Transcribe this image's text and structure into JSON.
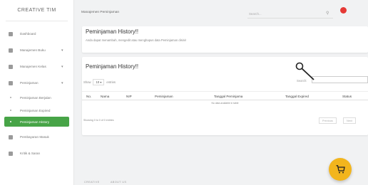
{
  "brand": "CREATIVE TIM",
  "sidebar": {
    "items": [
      {
        "label": "Dashboard"
      },
      {
        "label": "Manajemen Buku"
      },
      {
        "label": "Manajemen Kelas"
      },
      {
        "label": "Peminjaman"
      }
    ],
    "sub_items": [
      {
        "label": "Peminjaman Berjalan"
      },
      {
        "label": "Peminjaman Expired"
      },
      {
        "label": "Peminjaman History"
      }
    ],
    "more_items": [
      {
        "label": "Pembayaran Masuk"
      },
      {
        "label": "Kritik & Saran"
      }
    ]
  },
  "topbar": {
    "breadcrumb": "Manajemen Peminjaman",
    "search_placeholder": "Search..."
  },
  "header_card": {
    "title": "Peminjaman History!!",
    "subtitle": "Anda dapat menambah, mengedit atau menghapus data Peminjaman disini!"
  },
  "table_card": {
    "title": "Peminjaman History!!",
    "show_label": "Show",
    "entries_value": "10",
    "entries_label": "entries",
    "search_label": "Search:",
    "columns": [
      "No.",
      "Nama",
      "NIP",
      "Peminjaman",
      "Tanggal Peminjama",
      "Tanggal Expired",
      "Status"
    ],
    "empty_message": "No data available in table",
    "info": "Showing 0 to 0 of 0 entries",
    "prev_label": "Previous",
    "next_label": "Next"
  },
  "footer": {
    "links": [
      "CREATIVE",
      "ABOUT US"
    ]
  },
  "colors": {
    "active_nav": "#47a447",
    "notification": "#e53935",
    "fab": "#f2b51d"
  }
}
